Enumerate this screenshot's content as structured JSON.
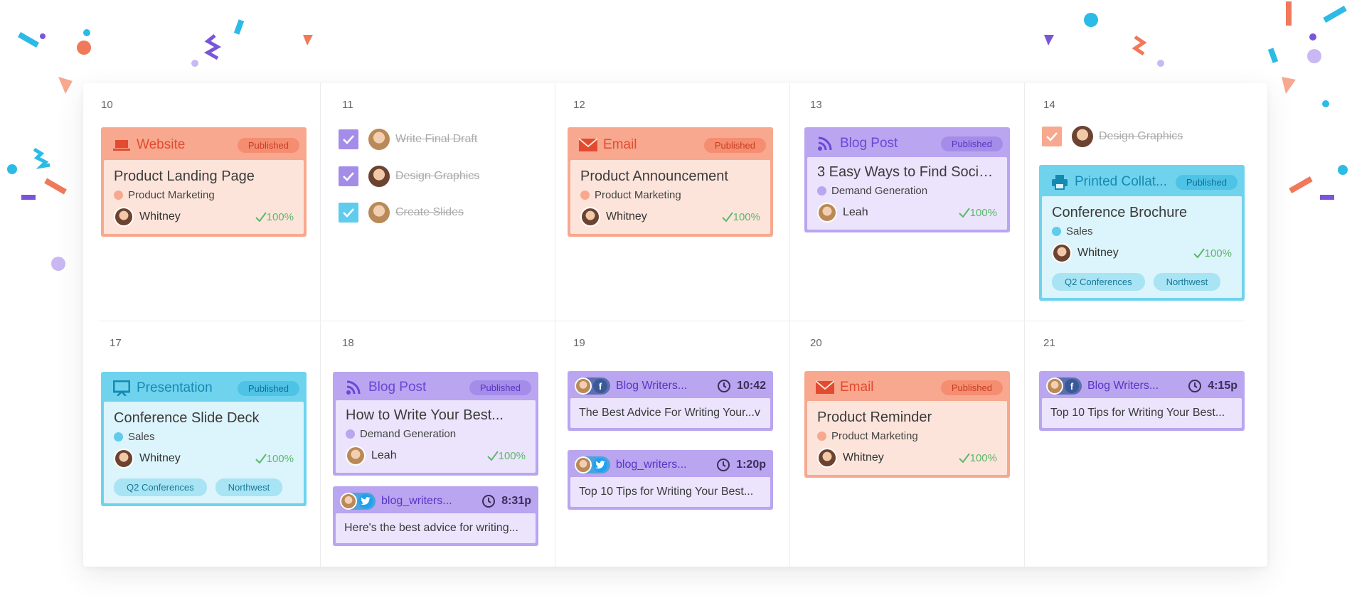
{
  "colors": {
    "orange": "#f7a88e",
    "purple": "#b9a5f0",
    "cyan": "#6fd3ee",
    "green": "#5bb86a"
  },
  "week1": {
    "d10": {
      "num": "10",
      "card": {
        "type": "Website",
        "status": "Published",
        "title": "Product Landing Page",
        "category": "Product Marketing",
        "owner": "Whitney",
        "progress": "100%"
      }
    },
    "d11": {
      "num": "11",
      "tasks": [
        {
          "label": "Write Final Draft"
        },
        {
          "label": "Design Graphics"
        },
        {
          "label": "Create Slides"
        }
      ]
    },
    "d12": {
      "num": "12",
      "card": {
        "type": "Email",
        "status": "Published",
        "title": "Product Announcement",
        "category": "Product Marketing",
        "owner": "Whitney",
        "progress": "100%"
      }
    },
    "d13": {
      "num": "13",
      "card": {
        "type": "Blog Post",
        "status": "Published",
        "title": "3 Easy Ways to Find Social...",
        "category": "Demand Generation",
        "owner": "Leah",
        "progress": "100%"
      }
    },
    "d14": {
      "num": "14",
      "task": {
        "label": "Design Graphics"
      },
      "card": {
        "type": "Printed Collat...",
        "status": "Published",
        "title": "Conference Brochure",
        "category": "Sales",
        "owner": "Whitney",
        "progress": "100%",
        "tags": [
          "Q2 Conferences",
          "Northwest"
        ]
      }
    }
  },
  "week2": {
    "d17": {
      "num": "17",
      "card": {
        "type": "Presentation",
        "status": "Published",
        "title": "Conference Slide Deck",
        "category": "Sales",
        "owner": "Whitney",
        "progress": "100%",
        "tags": [
          "Q2 Conferences",
          "Northwest"
        ]
      }
    },
    "d18": {
      "num": "18",
      "card": {
        "type": "Blog Post",
        "status": "Published",
        "title": "How to Write Your Best...",
        "category": "Demand Generation",
        "owner": "Leah",
        "progress": "100%"
      },
      "social": {
        "account": "blog_writers...",
        "time": "8:31p",
        "text": "Here's the best advice for writing..."
      }
    },
    "d19": {
      "num": "19",
      "social1": {
        "account": "Blog Writers...",
        "time": "10:42",
        "text": "The Best Advice For Writing Your...v"
      },
      "social2": {
        "account": "blog_writers...",
        "time": "1:20p",
        "text": "Top 10 Tips for Writing Your Best..."
      }
    },
    "d20": {
      "num": "20",
      "card": {
        "type": "Email",
        "status": "Published",
        "title": "Product Reminder",
        "category": "Product Marketing",
        "owner": "Whitney",
        "progress": "100%"
      }
    },
    "d21": {
      "num": "21",
      "social": {
        "account": "Blog Writers...",
        "time": "4:15p",
        "text": "Top 10 Tips for Writing Your Best..."
      }
    }
  }
}
